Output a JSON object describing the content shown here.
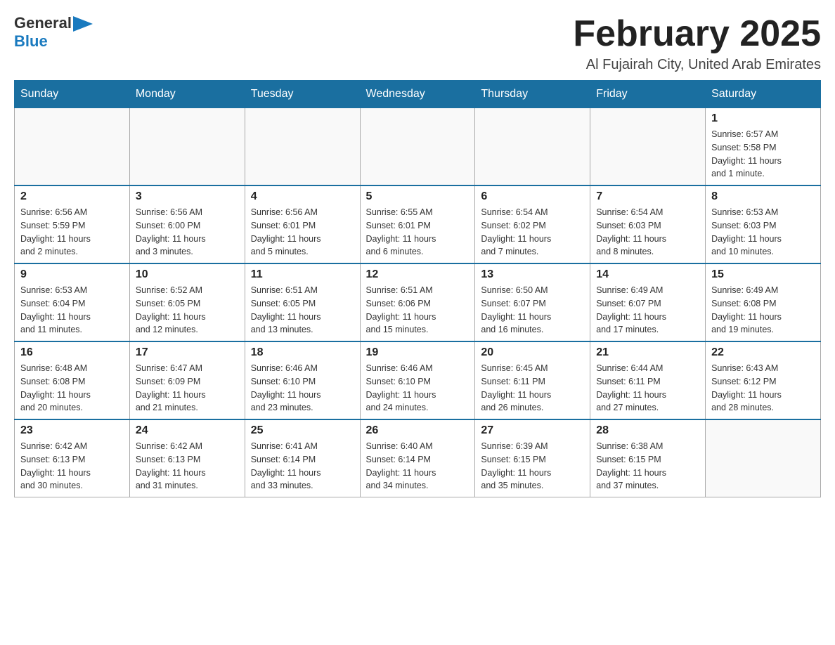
{
  "header": {
    "logo_general": "General",
    "logo_blue": "Blue",
    "month_title": "February 2025",
    "subtitle": "Al Fujairah City, United Arab Emirates"
  },
  "days_of_week": [
    "Sunday",
    "Monday",
    "Tuesday",
    "Wednesday",
    "Thursday",
    "Friday",
    "Saturday"
  ],
  "weeks": [
    [
      {
        "day": "",
        "info": ""
      },
      {
        "day": "",
        "info": ""
      },
      {
        "day": "",
        "info": ""
      },
      {
        "day": "",
        "info": ""
      },
      {
        "day": "",
        "info": ""
      },
      {
        "day": "",
        "info": ""
      },
      {
        "day": "1",
        "info": "Sunrise: 6:57 AM\nSunset: 5:58 PM\nDaylight: 11 hours\nand 1 minute."
      }
    ],
    [
      {
        "day": "2",
        "info": "Sunrise: 6:56 AM\nSunset: 5:59 PM\nDaylight: 11 hours\nand 2 minutes."
      },
      {
        "day": "3",
        "info": "Sunrise: 6:56 AM\nSunset: 6:00 PM\nDaylight: 11 hours\nand 3 minutes."
      },
      {
        "day": "4",
        "info": "Sunrise: 6:56 AM\nSunset: 6:01 PM\nDaylight: 11 hours\nand 5 minutes."
      },
      {
        "day": "5",
        "info": "Sunrise: 6:55 AM\nSunset: 6:01 PM\nDaylight: 11 hours\nand 6 minutes."
      },
      {
        "day": "6",
        "info": "Sunrise: 6:54 AM\nSunset: 6:02 PM\nDaylight: 11 hours\nand 7 minutes."
      },
      {
        "day": "7",
        "info": "Sunrise: 6:54 AM\nSunset: 6:03 PM\nDaylight: 11 hours\nand 8 minutes."
      },
      {
        "day": "8",
        "info": "Sunrise: 6:53 AM\nSunset: 6:03 PM\nDaylight: 11 hours\nand 10 minutes."
      }
    ],
    [
      {
        "day": "9",
        "info": "Sunrise: 6:53 AM\nSunset: 6:04 PM\nDaylight: 11 hours\nand 11 minutes."
      },
      {
        "day": "10",
        "info": "Sunrise: 6:52 AM\nSunset: 6:05 PM\nDaylight: 11 hours\nand 12 minutes."
      },
      {
        "day": "11",
        "info": "Sunrise: 6:51 AM\nSunset: 6:05 PM\nDaylight: 11 hours\nand 13 minutes."
      },
      {
        "day": "12",
        "info": "Sunrise: 6:51 AM\nSunset: 6:06 PM\nDaylight: 11 hours\nand 15 minutes."
      },
      {
        "day": "13",
        "info": "Sunrise: 6:50 AM\nSunset: 6:07 PM\nDaylight: 11 hours\nand 16 minutes."
      },
      {
        "day": "14",
        "info": "Sunrise: 6:49 AM\nSunset: 6:07 PM\nDaylight: 11 hours\nand 17 minutes."
      },
      {
        "day": "15",
        "info": "Sunrise: 6:49 AM\nSunset: 6:08 PM\nDaylight: 11 hours\nand 19 minutes."
      }
    ],
    [
      {
        "day": "16",
        "info": "Sunrise: 6:48 AM\nSunset: 6:08 PM\nDaylight: 11 hours\nand 20 minutes."
      },
      {
        "day": "17",
        "info": "Sunrise: 6:47 AM\nSunset: 6:09 PM\nDaylight: 11 hours\nand 21 minutes."
      },
      {
        "day": "18",
        "info": "Sunrise: 6:46 AM\nSunset: 6:10 PM\nDaylight: 11 hours\nand 23 minutes."
      },
      {
        "day": "19",
        "info": "Sunrise: 6:46 AM\nSunset: 6:10 PM\nDaylight: 11 hours\nand 24 minutes."
      },
      {
        "day": "20",
        "info": "Sunrise: 6:45 AM\nSunset: 6:11 PM\nDaylight: 11 hours\nand 26 minutes."
      },
      {
        "day": "21",
        "info": "Sunrise: 6:44 AM\nSunset: 6:11 PM\nDaylight: 11 hours\nand 27 minutes."
      },
      {
        "day": "22",
        "info": "Sunrise: 6:43 AM\nSunset: 6:12 PM\nDaylight: 11 hours\nand 28 minutes."
      }
    ],
    [
      {
        "day": "23",
        "info": "Sunrise: 6:42 AM\nSunset: 6:13 PM\nDaylight: 11 hours\nand 30 minutes."
      },
      {
        "day": "24",
        "info": "Sunrise: 6:42 AM\nSunset: 6:13 PM\nDaylight: 11 hours\nand 31 minutes."
      },
      {
        "day": "25",
        "info": "Sunrise: 6:41 AM\nSunset: 6:14 PM\nDaylight: 11 hours\nand 33 minutes."
      },
      {
        "day": "26",
        "info": "Sunrise: 6:40 AM\nSunset: 6:14 PM\nDaylight: 11 hours\nand 34 minutes."
      },
      {
        "day": "27",
        "info": "Sunrise: 6:39 AM\nSunset: 6:15 PM\nDaylight: 11 hours\nand 35 minutes."
      },
      {
        "day": "28",
        "info": "Sunrise: 6:38 AM\nSunset: 6:15 PM\nDaylight: 11 hours\nand 37 minutes."
      },
      {
        "day": "",
        "info": ""
      }
    ]
  ]
}
